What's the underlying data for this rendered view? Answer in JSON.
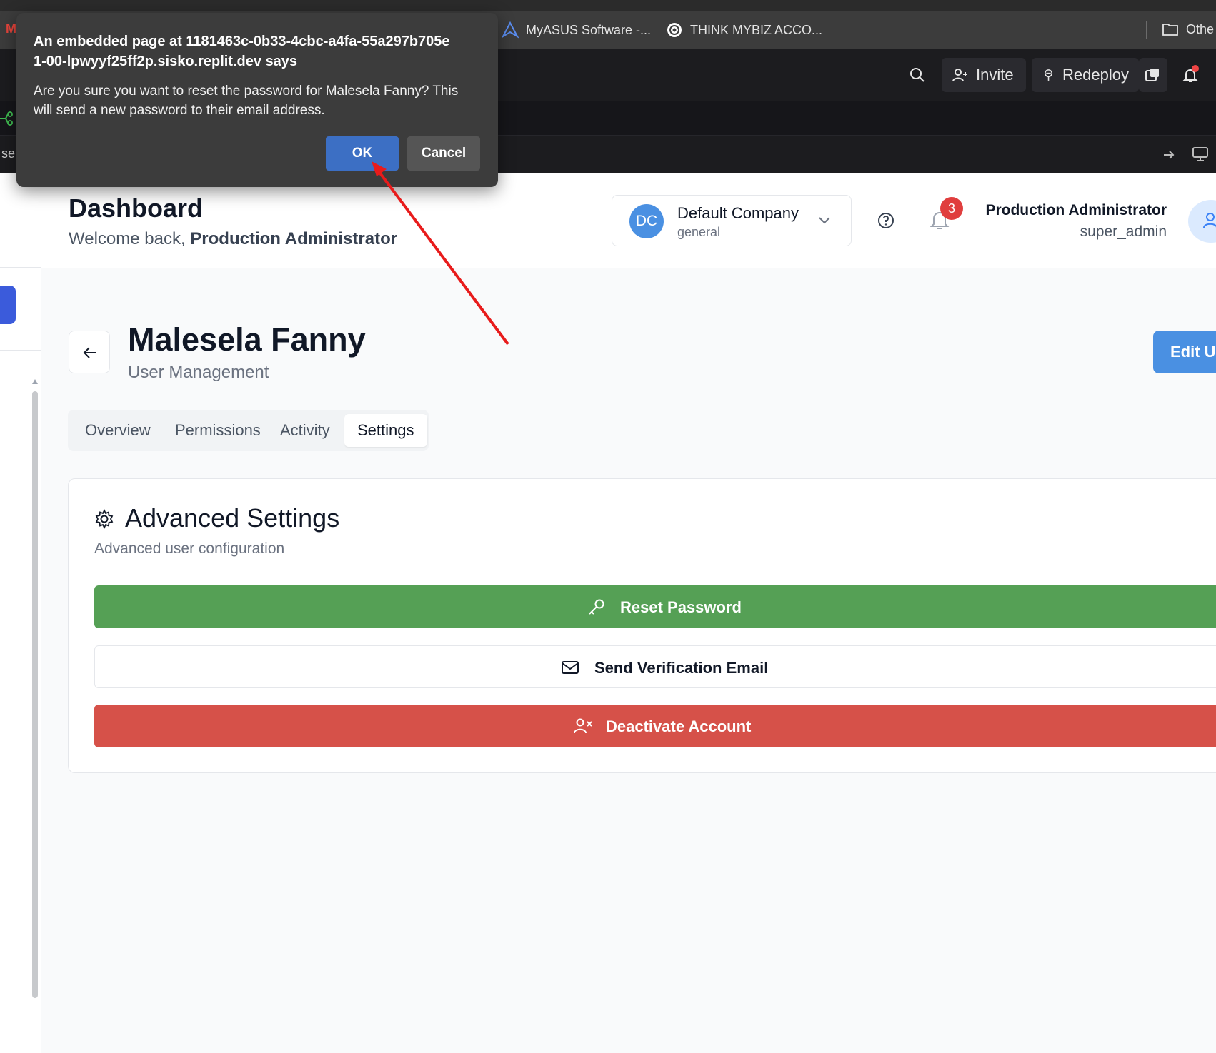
{
  "bookmarks": [
    {
      "label": "MyASUS Software -...",
      "icon": "myasus-logo-icon"
    },
    {
      "label": "THINK MYBIZ ACCO...",
      "icon": "openai-logo-icon"
    },
    {
      "label": "Othe",
      "icon": "folder-icon"
    }
  ],
  "replit_toolbar": {
    "invite_label": "Invite",
    "redeploy_label": "Redeploy",
    "url_fragment": "ser"
  },
  "header": {
    "title": "Dashboard",
    "welcome_prefix": "Welcome back, ",
    "welcome_name": "Production Administrator",
    "company": {
      "initials": "DC",
      "name": "Default Company",
      "type": "general"
    },
    "notification_count": "3",
    "user": {
      "name": "Production Administrator",
      "role": "super_admin"
    }
  },
  "page": {
    "user_name": "Malesela Fanny",
    "subtitle": "User Management",
    "edit_button": "Edit Us"
  },
  "tabs": [
    {
      "label": "Overview",
      "active": false
    },
    {
      "label": "Permissions",
      "active": false
    },
    {
      "label": "Activity",
      "active": false
    },
    {
      "label": "Settings",
      "active": true
    }
  ],
  "card": {
    "title": "Advanced Settings",
    "subtitle": "Advanced user configuration",
    "actions": {
      "reset": "Reset Password",
      "verify": "Send Verification Email",
      "deactivate": "Deactivate Account"
    }
  },
  "dialog": {
    "title": "An embedded page at 1181463c-0b33-4cbc-a4fa-55a297b705e1-00-lpwyyf25ff2p.sisko.replit.dev says",
    "message": "Are you sure you want to reset the password for Malesela Fanny? This will send a new password to their email address.",
    "ok_label": "OK",
    "cancel_label": "Cancel"
  },
  "colors": {
    "reset_green": "#55a055",
    "deactivate_red": "#d65149",
    "primary_blue": "#4a90e2",
    "dialog_ok_blue": "#3c6fc4",
    "annotation_arrow": "#e81b1b"
  }
}
